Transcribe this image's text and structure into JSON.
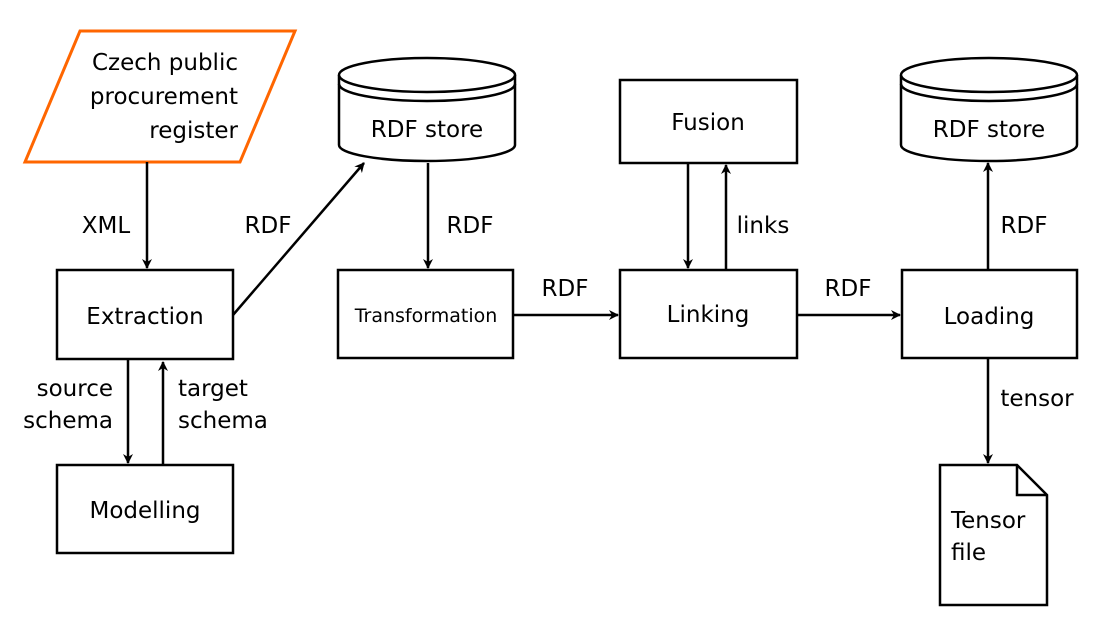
{
  "colors": {
    "source_outline": "#ff6600",
    "stroke": "#000000"
  },
  "nodes": {
    "source": [
      "Czech public",
      "procurement",
      "register"
    ],
    "rdf_store_1": "RDF store",
    "extraction": "Extraction",
    "transformation": "Transformation",
    "fusion": "Fusion",
    "linking": "Linking",
    "loading": "Loading",
    "rdf_store_2": "RDF store",
    "modelling": "Modelling",
    "tensor_file": [
      "Tensor",
      "file"
    ]
  },
  "edges": {
    "source_to_extraction": "XML",
    "extraction_to_store": "RDF",
    "store_to_transformation": "RDF",
    "transformation_to_linking": "RDF",
    "fusion_linking": "links",
    "linking_to_loading": "RDF",
    "loading_to_store": "RDF",
    "loading_to_tensor": "tensor",
    "extraction_to_modelling": [
      "source",
      "schema"
    ],
    "modelling_to_extraction": [
      "target",
      "schema"
    ]
  }
}
